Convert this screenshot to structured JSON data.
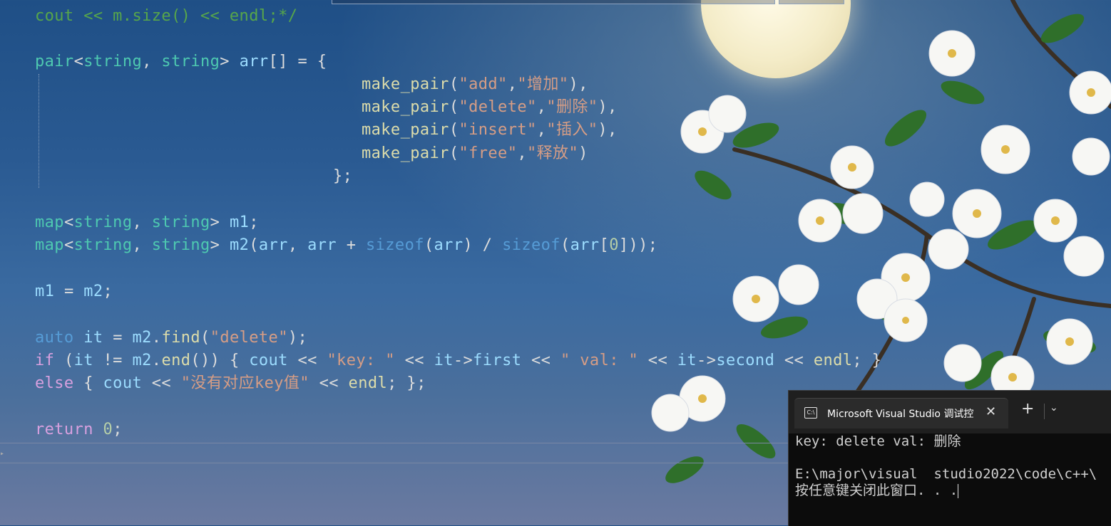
{
  "editor": {
    "lines": [
      {
        "id": "l0",
        "tokens": [
          {
            "t": "cout << m.size() << endl;*/",
            "c": "c"
          }
        ]
      },
      {
        "id": "l1",
        "tokens": [
          {
            "t": "pair",
            "c": "t"
          },
          {
            "t": "<",
            "c": "p"
          },
          {
            "t": "string",
            "c": "t"
          },
          {
            "t": ", ",
            "c": "p"
          },
          {
            "t": "string",
            "c": "t"
          },
          {
            "t": "> ",
            "c": "p"
          },
          {
            "t": "arr",
            "c": "v"
          },
          {
            "t": "[] = {",
            "c": "p"
          }
        ]
      },
      {
        "id": "l2",
        "tokens": [
          {
            "t": "make_pair",
            "c": "f"
          },
          {
            "t": "(",
            "c": "p"
          },
          {
            "t": "\"add\"",
            "c": "s"
          },
          {
            "t": ",",
            "c": "p"
          },
          {
            "t": "\"增加\"",
            "c": "s"
          },
          {
            "t": "),",
            "c": "p"
          }
        ]
      },
      {
        "id": "l3",
        "tokens": [
          {
            "t": "make_pair",
            "c": "f"
          },
          {
            "t": "(",
            "c": "p"
          },
          {
            "t": "\"delete\"",
            "c": "s"
          },
          {
            "t": ",",
            "c": "p"
          },
          {
            "t": "\"删除\"",
            "c": "s"
          },
          {
            "t": "),",
            "c": "p"
          }
        ]
      },
      {
        "id": "l4",
        "tokens": [
          {
            "t": "make_pair",
            "c": "f"
          },
          {
            "t": "(",
            "c": "p"
          },
          {
            "t": "\"insert\"",
            "c": "s"
          },
          {
            "t": ",",
            "c": "p"
          },
          {
            "t": "\"插入\"",
            "c": "s"
          },
          {
            "t": "),",
            "c": "p"
          }
        ]
      },
      {
        "id": "l5",
        "tokens": [
          {
            "t": "make_pair",
            "c": "f"
          },
          {
            "t": "(",
            "c": "p"
          },
          {
            "t": "\"free\"",
            "c": "s"
          },
          {
            "t": ",",
            "c": "p"
          },
          {
            "t": "\"释放\"",
            "c": "s"
          },
          {
            "t": ")",
            "c": "p"
          }
        ]
      },
      {
        "id": "l6",
        "tokens": [
          {
            "t": "};",
            "c": "p"
          }
        ]
      },
      {
        "id": "l7",
        "tokens": [
          {
            "t": "map",
            "c": "t"
          },
          {
            "t": "<",
            "c": "p"
          },
          {
            "t": "string",
            "c": "t"
          },
          {
            "t": ", ",
            "c": "p"
          },
          {
            "t": "string",
            "c": "t"
          },
          {
            "t": "> ",
            "c": "p"
          },
          {
            "t": "m1",
            "c": "v"
          },
          {
            "t": ";",
            "c": "p"
          }
        ]
      },
      {
        "id": "l8",
        "tokens": [
          {
            "t": "map",
            "c": "t"
          },
          {
            "t": "<",
            "c": "p"
          },
          {
            "t": "string",
            "c": "t"
          },
          {
            "t": ", ",
            "c": "p"
          },
          {
            "t": "string",
            "c": "t"
          },
          {
            "t": "> ",
            "c": "p"
          },
          {
            "t": "m2",
            "c": "v"
          },
          {
            "t": "(",
            "c": "p"
          },
          {
            "t": "arr",
            "c": "v"
          },
          {
            "t": ", ",
            "c": "p"
          },
          {
            "t": "arr",
            "c": "v"
          },
          {
            "t": " + ",
            "c": "p"
          },
          {
            "t": "sizeof",
            "c": "k"
          },
          {
            "t": "(",
            "c": "p"
          },
          {
            "t": "arr",
            "c": "v"
          },
          {
            "t": ") / ",
            "c": "p"
          },
          {
            "t": "sizeof",
            "c": "k"
          },
          {
            "t": "(",
            "c": "p"
          },
          {
            "t": "arr",
            "c": "v"
          },
          {
            "t": "[",
            "c": "p"
          },
          {
            "t": "0",
            "c": "n"
          },
          {
            "t": "]));",
            "c": "p"
          }
        ]
      },
      {
        "id": "l9",
        "tokens": [
          {
            "t": "m1",
            "c": "v"
          },
          {
            "t": " = ",
            "c": "p"
          },
          {
            "t": "m2",
            "c": "v"
          },
          {
            "t": ";",
            "c": "p"
          }
        ]
      },
      {
        "id": "l10",
        "tokens": [
          {
            "t": "auto",
            "c": "k"
          },
          {
            "t": " ",
            "c": "p"
          },
          {
            "t": "it",
            "c": "v"
          },
          {
            "t": " = ",
            "c": "p"
          },
          {
            "t": "m2",
            "c": "v"
          },
          {
            "t": ".",
            "c": "p"
          },
          {
            "t": "find",
            "c": "f"
          },
          {
            "t": "(",
            "c": "p"
          },
          {
            "t": "\"delete\"",
            "c": "s"
          },
          {
            "t": ");",
            "c": "p"
          }
        ]
      },
      {
        "id": "l11",
        "tokens": [
          {
            "t": "if",
            "c": "ctl"
          },
          {
            "t": " (",
            "c": "p"
          },
          {
            "t": "it",
            "c": "v"
          },
          {
            "t": " != ",
            "c": "p"
          },
          {
            "t": "m2",
            "c": "v"
          },
          {
            "t": ".",
            "c": "p"
          },
          {
            "t": "end",
            "c": "f"
          },
          {
            "t": "()) { ",
            "c": "p"
          },
          {
            "t": "cout",
            "c": "v"
          },
          {
            "t": " << ",
            "c": "p"
          },
          {
            "t": "\"key: \"",
            "c": "s"
          },
          {
            "t": " << ",
            "c": "p"
          },
          {
            "t": "it",
            "c": "v"
          },
          {
            "t": "->",
            "c": "p"
          },
          {
            "t": "first",
            "c": "v"
          },
          {
            "t": " << ",
            "c": "p"
          },
          {
            "t": "\" val: \"",
            "c": "s"
          },
          {
            "t": " << ",
            "c": "p"
          },
          {
            "t": "it",
            "c": "v"
          },
          {
            "t": "->",
            "c": "p"
          },
          {
            "t": "second",
            "c": "v"
          },
          {
            "t": " << ",
            "c": "p"
          },
          {
            "t": "endl",
            "c": "f"
          },
          {
            "t": "; }",
            "c": "p"
          }
        ]
      },
      {
        "id": "l12",
        "tokens": [
          {
            "t": "else",
            "c": "ctl"
          },
          {
            "t": " { ",
            "c": "p"
          },
          {
            "t": "cout",
            "c": "v"
          },
          {
            "t": " << ",
            "c": "p"
          },
          {
            "t": "\"没有对应key值\"",
            "c": "s"
          },
          {
            "t": " << ",
            "c": "p"
          },
          {
            "t": "endl",
            "c": "f"
          },
          {
            "t": "; };",
            "c": "p"
          }
        ]
      },
      {
        "id": "l13",
        "tokens": [
          {
            "t": "return",
            "c": "ctl"
          },
          {
            "t": " ",
            "c": "p"
          },
          {
            "t": "0",
            "c": "n"
          },
          {
            "t": ";",
            "c": "p"
          }
        ]
      }
    ]
  },
  "terminal": {
    "tab_title": "Microsoft Visual Studio 调试控",
    "tab_icon_text": "C:\\",
    "close_glyph": "✕",
    "add_glyph": "+",
    "dropdown_glyph": "⌄",
    "output": [
      "key: delete val: 删除",
      "",
      "E:\\major\\visual  studio2022\\code\\c++\\",
      "按任意键关闭此窗口. . ."
    ]
  }
}
